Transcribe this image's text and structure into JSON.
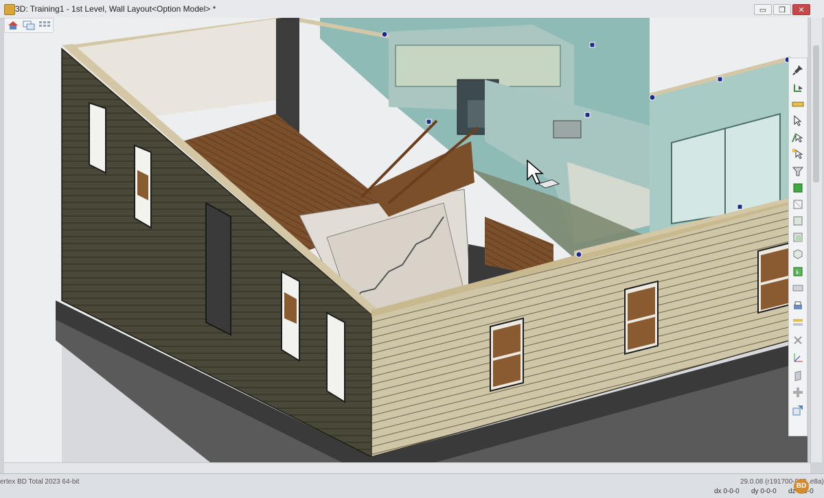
{
  "window": {
    "title": "3D: Training1 - 1st Level, Wall Layout<Option Model> *",
    "minimize_glyph": "▭",
    "restore_glyph": "❐",
    "close_glyph": "✕"
  },
  "view_toolbar": {
    "icons": [
      "house-view-icon",
      "window-tile-icon",
      "grid-view-icon"
    ]
  },
  "right_toolbar": {
    "icons": [
      "pin-icon",
      "rotate-select-icon",
      "ruler-icon",
      "select-objects-icon",
      "select-edge-icon",
      "select-group-icon",
      "filter-icon",
      "cube-solid-icon",
      "cube-wire-icon",
      "cube-front-icon",
      "cube-back-icon",
      "cube-side-icon",
      "cube-select-icon",
      "layer-icon",
      "print-icon",
      "layer-stack-icon",
      "delete-icon",
      "axis-icon",
      "panel-icon",
      "add-icon",
      "transfer-icon"
    ]
  },
  "status": {
    "app_name": "ertex BD Total  2023  64-bit",
    "version": "29.0.08 (r191700-9??..e8a)",
    "dx": "dx 0-0-0",
    "dy": "dy 0-0-0",
    "dz": "dz 0-0-0"
  },
  "avatar": {
    "initials": "BD"
  },
  "colors": {
    "siding_dark": "#4a4838",
    "siding_light": "#cfc6a8",
    "floor_wood": "#7a4f2a",
    "kitchen_tint": "#7fb1ac",
    "selection_handle": "#1a2a8a"
  }
}
